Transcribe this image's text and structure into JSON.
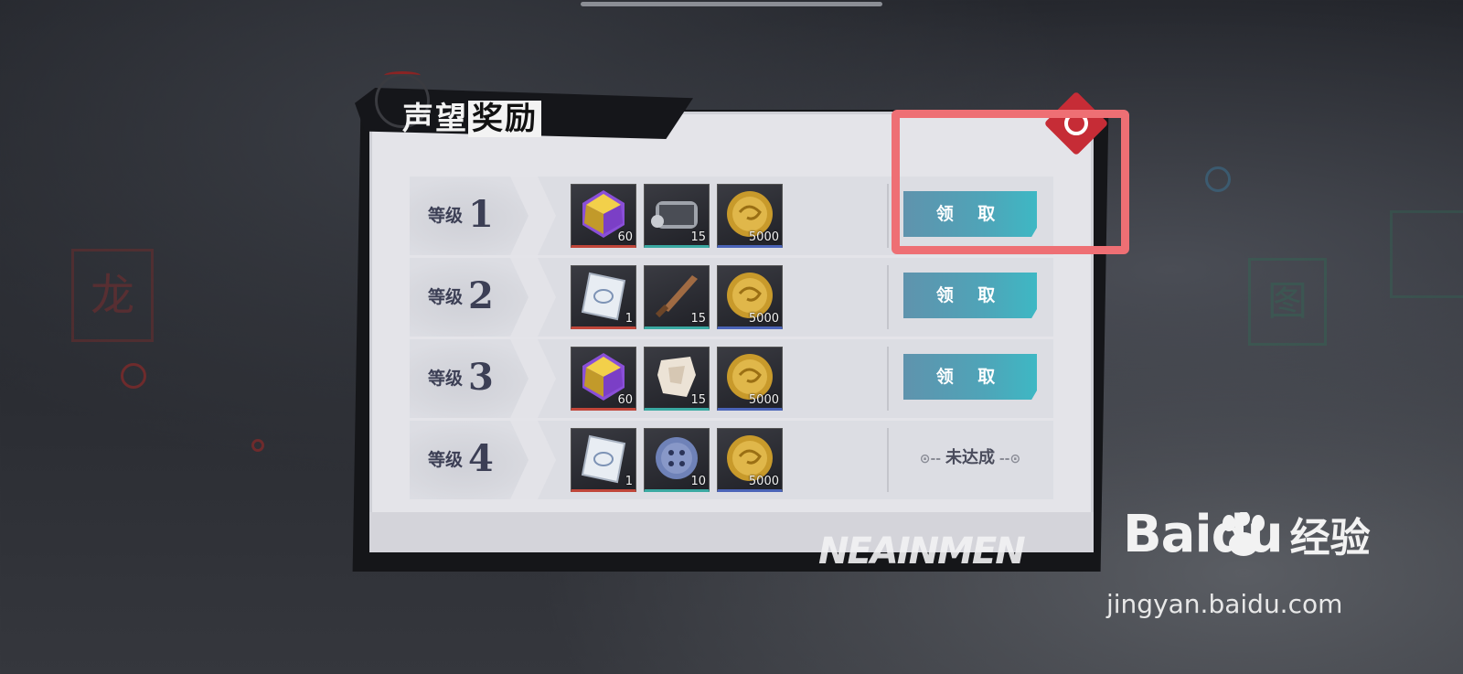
{
  "window": {
    "title_part1": "声望",
    "title_part2": "奖励",
    "bottom_text": "NEAINMEN"
  },
  "background": {
    "seal_left": "龙",
    "seal_right": "图"
  },
  "rows": [
    {
      "label": "等级",
      "level": "1",
      "items": [
        {
          "icon": "purple-gem-icon",
          "qty": "60",
          "rarity": "r-red"
        },
        {
          "icon": "film-reel-icon",
          "qty": "15",
          "rarity": "r-teal"
        },
        {
          "icon": "gold-coin-icon",
          "qty": "5000",
          "rarity": "r-blue"
        }
      ],
      "status": "claim",
      "claim_label": "领 取"
    },
    {
      "label": "等级",
      "level": "2",
      "items": [
        {
          "icon": "card-ticket-icon",
          "qty": "1",
          "rarity": "r-red"
        },
        {
          "icon": "wooden-dagger-icon",
          "qty": "15",
          "rarity": "r-teal"
        },
        {
          "icon": "gold-coin-icon",
          "qty": "5000",
          "rarity": "r-blue"
        }
      ],
      "status": "claim",
      "claim_label": "领 取"
    },
    {
      "label": "等级",
      "level": "3",
      "items": [
        {
          "icon": "purple-gem-icon",
          "qty": "60",
          "rarity": "r-red"
        },
        {
          "icon": "paper-scrap-icon",
          "qty": "15",
          "rarity": "r-teal"
        },
        {
          "icon": "gold-coin-icon",
          "qty": "5000",
          "rarity": "r-blue"
        }
      ],
      "status": "claim",
      "claim_label": "领 取"
    },
    {
      "label": "等级",
      "level": "4",
      "items": [
        {
          "icon": "card-ticket-icon",
          "qty": "1",
          "rarity": "r-red"
        },
        {
          "icon": "blue-button-icon",
          "qty": "10",
          "rarity": "r-teal"
        },
        {
          "icon": "gold-coin-icon",
          "qty": "5000",
          "rarity": "r-blue"
        }
      ],
      "status": "unmet",
      "unmet_label": "未达成"
    }
  ],
  "watermark": {
    "brand": "Bai",
    "brand2": "du",
    "cn": "经验",
    "url": "jingyan.baidu.com"
  },
  "colors": {
    "accent_button": "#4fa4b8",
    "close_red": "#c62c36",
    "highlight": "#ee6f74"
  }
}
